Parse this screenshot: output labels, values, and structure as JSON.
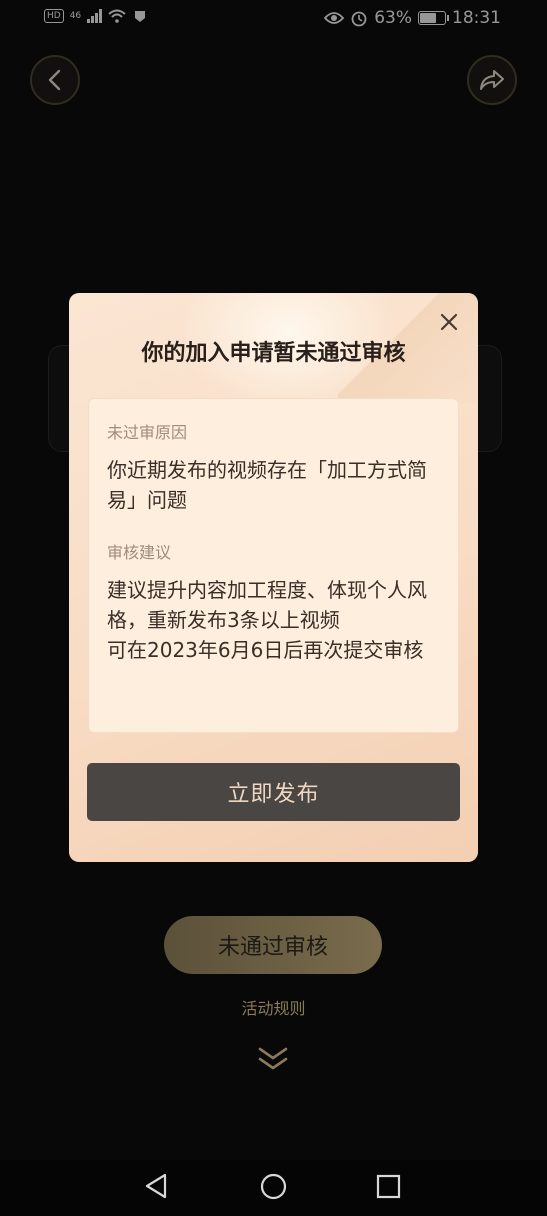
{
  "status_bar": {
    "left_badges": [
      "HD",
      "46"
    ],
    "battery_percent_text": "63%",
    "battery_level": 0.63,
    "time": "18:31",
    "icons": [
      "signal-icon",
      "wifi-icon",
      "notification-icon",
      "eye-icon",
      "alarm-icon",
      "battery-icon"
    ]
  },
  "top_nav": {
    "back_icon": "chevron-left-icon",
    "share_icon": "share-arrow-icon"
  },
  "modal": {
    "title": "你的加入申请暂未通过审核",
    "close_icon": "close-icon",
    "reason_label": "未过审原因",
    "reason_text": "你近期发布的视频存在「加工方式简易」问题",
    "suggestion_label": "审核建议",
    "suggestion_line1": "建议提升内容加工程度、体现个人风格，重新发布3条以上视频",
    "suggestion_line2": "可在2023年6月6日后再次提交审核",
    "publish_button": "立即发布"
  },
  "page": {
    "status_button": "未通过审核",
    "rules_link": "活动规则",
    "more_icon": "double-chevron-down-icon"
  },
  "colors": {
    "modal_bg": "#fbe6d3",
    "button_bg": "#4a4643",
    "button_text": "#f1d7bf",
    "accent_gold": "#7a6c4d"
  }
}
